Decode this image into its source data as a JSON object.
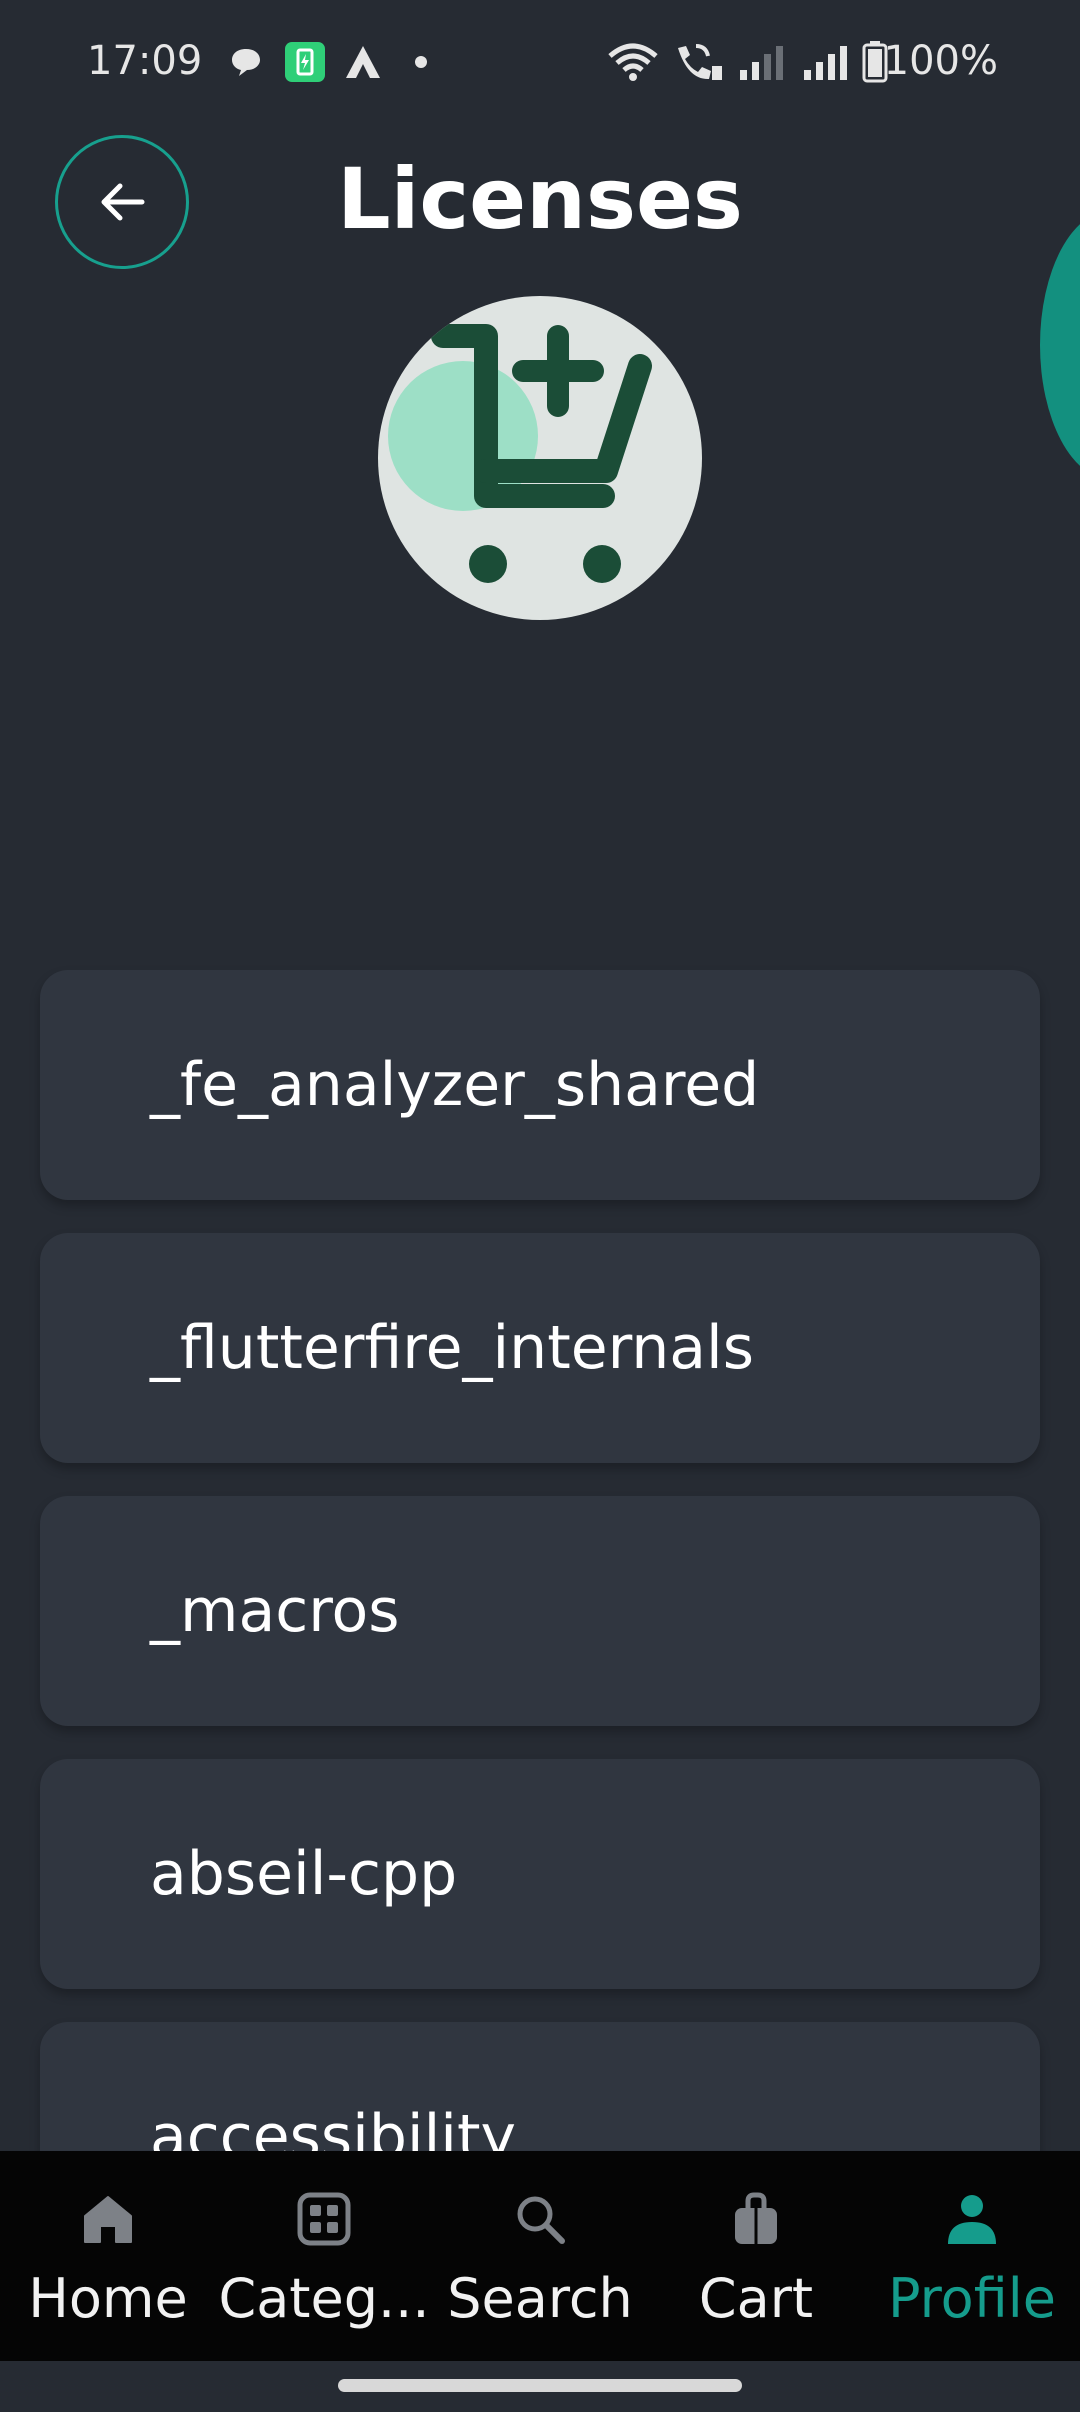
{
  "status_bar": {
    "time": "17:09",
    "battery": "100%",
    "icons": [
      "chat-bubble-icon",
      "battery-saver-app-icon",
      "delta-app-icon",
      "dot-icon",
      "wifi-icon",
      "wifi-calling-icon",
      "signal-weak-icon",
      "signal-full-icon",
      "battery-icon"
    ]
  },
  "header": {
    "title": "Licenses",
    "back_icon": "arrow-left-icon"
  },
  "logo": {
    "icon": "cart-plus-icon",
    "colors": {
      "background": "#dfe4e2",
      "cart": "#1b4d37",
      "accent": "#9ddfc6"
    }
  },
  "licenses": [
    {
      "name": "_fe_analyzer_shared"
    },
    {
      "name": "_flutterfire_internals"
    },
    {
      "name": "_macros"
    },
    {
      "name": "abseil-cpp"
    },
    {
      "name": "accessibility"
    }
  ],
  "bottom_nav": {
    "items": [
      {
        "label": "Home",
        "icon": "home-icon",
        "active": false
      },
      {
        "label": "Categ...",
        "icon": "grid-icon",
        "active": false
      },
      {
        "label": "Search",
        "icon": "search-icon",
        "active": false
      },
      {
        "label": "Cart",
        "icon": "shopping-bag-icon",
        "active": false
      },
      {
        "label": "Profile",
        "icon": "person-icon",
        "active": true
      }
    ]
  },
  "colors": {
    "background": "#262b33",
    "card": "#303640",
    "accent": "#159c8c",
    "nav_background": "#050505"
  }
}
